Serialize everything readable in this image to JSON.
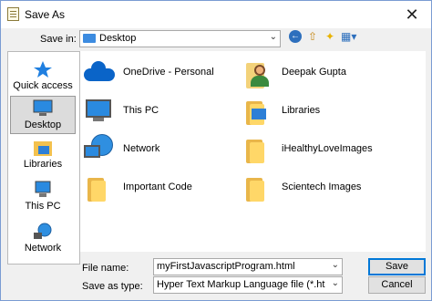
{
  "window": {
    "title": "Save As",
    "close_glyph": "✕"
  },
  "savein": {
    "label": "Save in:",
    "value": "Desktop"
  },
  "toolbar": {
    "icons": [
      "back-icon",
      "up-folder-icon",
      "new-folder-icon",
      "view-menu-icon"
    ]
  },
  "places": [
    {
      "label": "Quick access",
      "icon": "star-icon"
    },
    {
      "label": "Desktop",
      "icon": "desktop-icon",
      "selected": true
    },
    {
      "label": "Libraries",
      "icon": "libraries-icon"
    },
    {
      "label": "This PC",
      "icon": "computer-icon"
    },
    {
      "label": "Network",
      "icon": "network-icon"
    }
  ],
  "items": [
    {
      "label": "OneDrive - Personal",
      "icon": "onedrive-icon"
    },
    {
      "label": "Deepak Gupta",
      "icon": "user-folder-icon"
    },
    {
      "label": "This PC",
      "icon": "computer-icon"
    },
    {
      "label": "Libraries",
      "icon": "libraries-icon"
    },
    {
      "label": "Network",
      "icon": "network-icon"
    },
    {
      "label": "iHealthyLoveImages",
      "icon": "folder-icon"
    },
    {
      "label": "Important Code",
      "icon": "folder-icon"
    },
    {
      "label": "Scientech Images",
      "icon": "folder-icon"
    }
  ],
  "filename": {
    "label": "File name:",
    "value": "myFirstJavascriptProgram.html"
  },
  "savetype": {
    "label": "Save as type:",
    "value": "Hyper Text Markup Language file (*.html;*.htm;*.shtml)"
  },
  "buttons": {
    "save": "Save",
    "cancel": "Cancel"
  },
  "colors": {
    "accent": "#0078d7",
    "folder": "#ffd768",
    "selection": "#dcdcdc"
  }
}
